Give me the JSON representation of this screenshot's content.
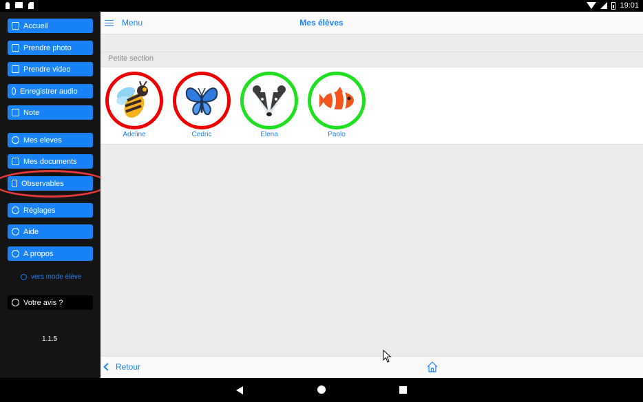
{
  "status_bar": {
    "time": "19:01"
  },
  "sidebar": {
    "items": [
      {
        "label": "Accueil",
        "icon": "home-icon"
      },
      {
        "label": "Prendre photo",
        "icon": "camera-icon"
      },
      {
        "label": "Prendre video",
        "icon": "video-icon"
      },
      {
        "label": "Enregistrer audio",
        "icon": "microphone-icon"
      },
      {
        "label": "Note",
        "icon": "note-icon"
      },
      {
        "label": "Mes eleves",
        "icon": "students-icon"
      },
      {
        "label": "Mes documents",
        "icon": "documents-icon"
      },
      {
        "label": "Observables",
        "icon": "bookmark-icon"
      },
      {
        "label": "Réglages",
        "icon": "settings-icon"
      },
      {
        "label": "Aide",
        "icon": "help-icon"
      },
      {
        "label": "A propos",
        "icon": "info-icon"
      }
    ],
    "mode_link": "vers mode élève",
    "feedback": "Votre avis ?",
    "version": "1.1.5"
  },
  "header": {
    "menu_label": "Menu",
    "title": "Mes élèves"
  },
  "section": {
    "label": "Petite section"
  },
  "students": [
    {
      "name": "Adeline",
      "animal": "bee-icon",
      "status": "red"
    },
    {
      "name": "Cedric",
      "animal": "butterfly-icon",
      "status": "red"
    },
    {
      "name": "Elena",
      "animal": "badger-icon",
      "status": "green"
    },
    {
      "name": "Paolo",
      "animal": "clownfish-icon",
      "status": "green"
    }
  ],
  "footer": {
    "back_label": "Retour"
  },
  "colors": {
    "accent": "#1a82f7",
    "red_ring": "#e00000",
    "green_ring": "#1ee01e",
    "sidebar_bg": "#141414"
  }
}
